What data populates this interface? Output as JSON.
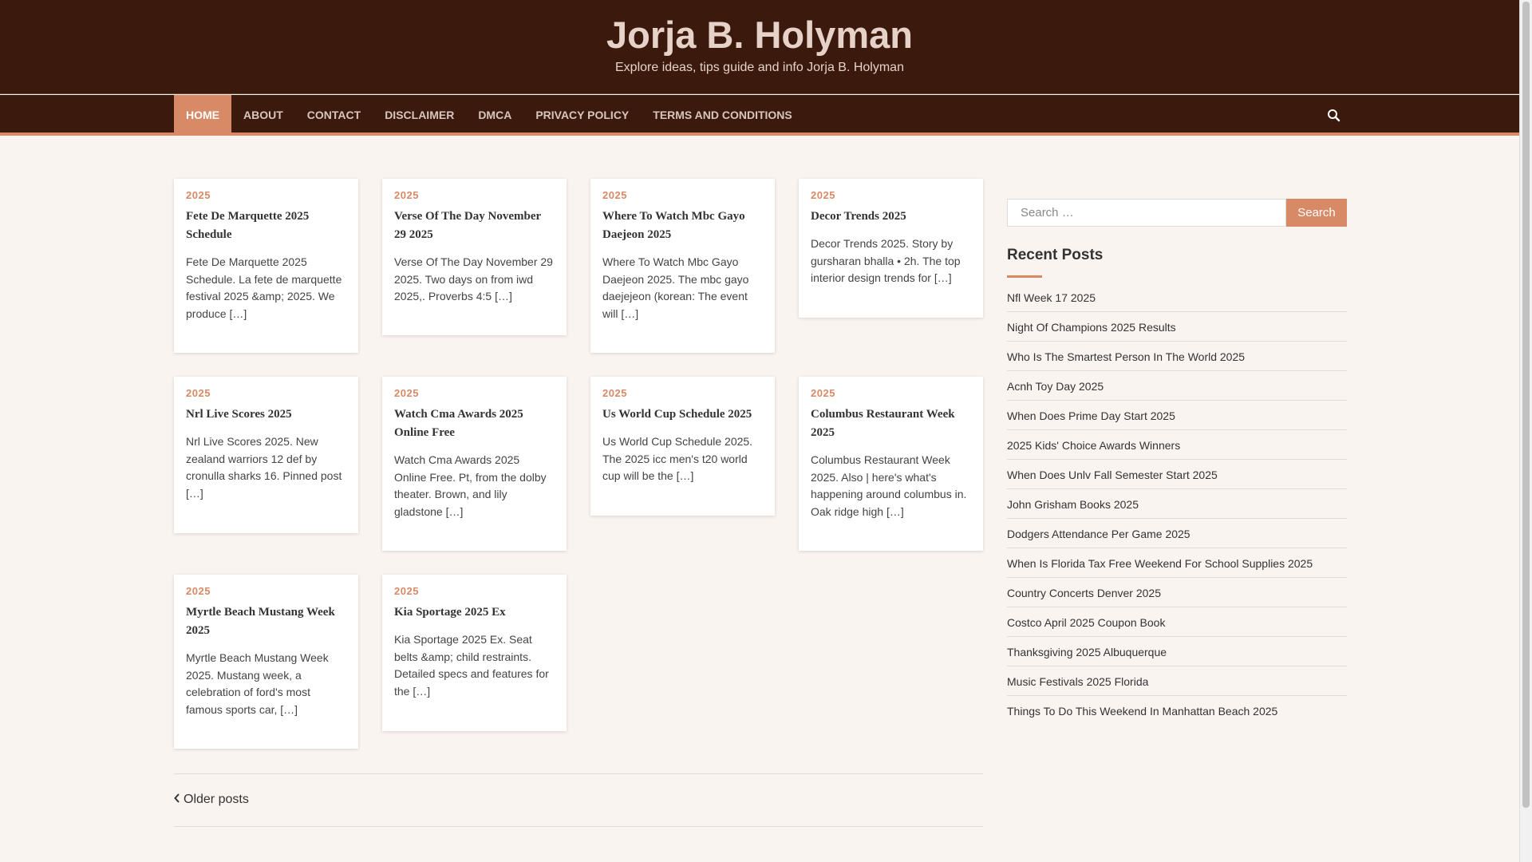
{
  "site": {
    "title": "Jorja B. Holyman",
    "tagline": "Explore ideas, tips guide and info Jorja B. Holyman"
  },
  "nav": {
    "items": [
      "HOME",
      "ABOUT",
      "CONTACT",
      "DISCLAIMER",
      "DMCA",
      "PRIVACY POLICY",
      "TERMS AND CONDITIONS"
    ],
    "active": "HOME",
    "search_icon": "search-icon"
  },
  "posts": [
    {
      "category": "2025",
      "title": "Fete De Marquette 2025 Schedule",
      "excerpt": "Fete De Marquette 2025 Schedule. La fete de marquette festival 2025 &amp; 2025. We produce […]"
    },
    {
      "category": "2025",
      "title": "Verse Of The Day November 29 2025",
      "excerpt": "Verse Of The Day November 29 2025. Two days on from iwd 2025,. Proverbs 4:5 […]"
    },
    {
      "category": "2025",
      "title": "Where To Watch Mbc Gayo Daejeon 2025",
      "excerpt": "Where To Watch Mbc Gayo Daejeon 2025. The mbc gayo daejejeon (korean: The event will […]"
    },
    {
      "category": "2025",
      "title": "Decor Trends 2025",
      "excerpt": "Decor Trends 2025. Story by gursharan bhalla • 2h. The top interior design trends for […]"
    },
    {
      "category": "2025",
      "title": "Nrl Live Scores 2025",
      "excerpt": "Nrl Live Scores 2025. New zealand warriors 12 def by cronulla sharks 16. Pinned post […]"
    },
    {
      "category": "2025",
      "title": "Watch Cma Awards 2025 Online Free",
      "excerpt": "Watch Cma Awards 2025 Online Free. Pt, from the dolby theater. Brown, and lily gladstone […]"
    },
    {
      "category": "2025",
      "title": "Us World Cup Schedule 2025",
      "excerpt": "Us World Cup Schedule 2025. The 2025 icc men's t20 world cup will be the […]"
    },
    {
      "category": "2025",
      "title": "Columbus Restaurant Week 2025",
      "excerpt": "Columbus Restaurant Week 2025. Also | here's what's happening around columbus in. Oak ridge high […]"
    },
    {
      "category": "2025",
      "title": "Myrtle Beach Mustang Week 2025",
      "excerpt": "Myrtle Beach Mustang Week 2025. Mustang week, a celebration of ford's most famous sports car, […]"
    },
    {
      "category": "2025",
      "title": "Kia Sportage 2025 Ex",
      "excerpt": "Kia Sportage 2025 Ex. Seat belts &amp; child restraints. Detailed specs and features for the […]"
    }
  ],
  "pagination": {
    "older_label": "Older posts"
  },
  "sidebar": {
    "search": {
      "placeholder": "Search …",
      "button_label": "Search"
    },
    "recent_title": "Recent Posts",
    "recent_posts": [
      "Nfl Week 17 2025",
      "Night Of Champions 2025 Results",
      "Who Is The Smartest Person In The World 2025",
      "Acnh Toy Day 2025",
      "When Does Prime Day Start 2025",
      "2025 Kids' Choice Awards Winners",
      "When Does Unlv Fall Semester Start 2025",
      "John Grisham Books 2025",
      "Dodgers Attendance Per Game 2025",
      "When Is Florida Tax Free Weekend For School Supplies 2025",
      "Country Concerts Denver 2025",
      "Costco April 2025 Coupon Book",
      "Thanksgiving 2025 Albuquerque",
      "Music Festivals 2025 Florida",
      "Things To Do This Weekend In Manhattan Beach 2025"
    ]
  },
  "colors": {
    "header_bg": "#3b1a0d",
    "accent": "#d88a67",
    "page_bg": "#faf4f1"
  }
}
